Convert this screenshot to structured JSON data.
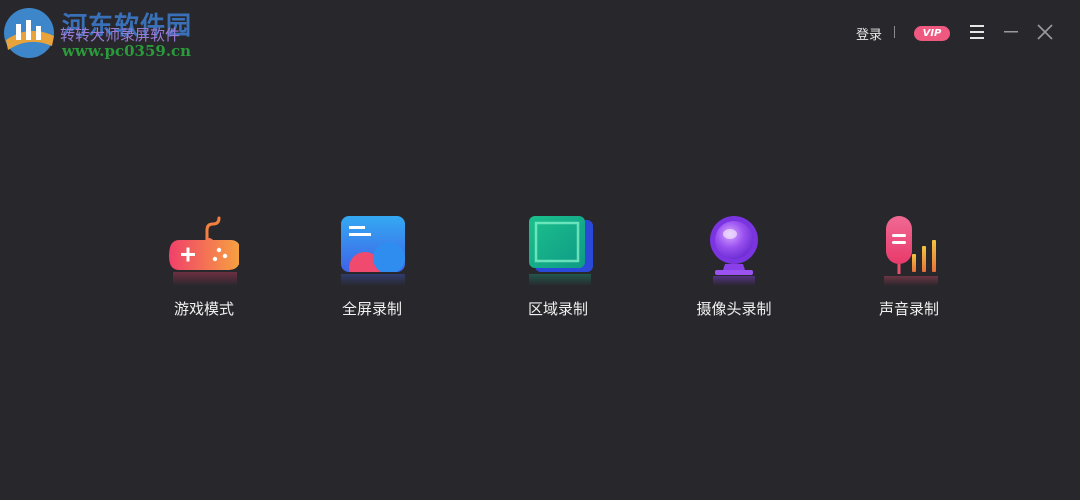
{
  "watermark": {
    "site_name": "河东软件园",
    "url": "www.pc0359.cn"
  },
  "app": {
    "title": "转转大师录屏软件"
  },
  "header": {
    "login_label": "登录",
    "vip_label": "VIP"
  },
  "icons": {
    "menu": "hamburger-menu-icon",
    "minimize": "minimize-icon",
    "close": "close-icon"
  },
  "modes": [
    {
      "label": "游戏模式",
      "icon": "gamepad-icon"
    },
    {
      "label": "全屏录制",
      "icon": "fullscreen-icon"
    },
    {
      "label": "区域录制",
      "icon": "region-icon"
    },
    {
      "label": "摄像头录制",
      "icon": "webcam-icon"
    },
    {
      "label": "声音录制",
      "icon": "microphone-icon"
    }
  ],
  "colors": {
    "background": "#28272c",
    "vip": "#f0597f",
    "text": "#f0f0f0"
  }
}
